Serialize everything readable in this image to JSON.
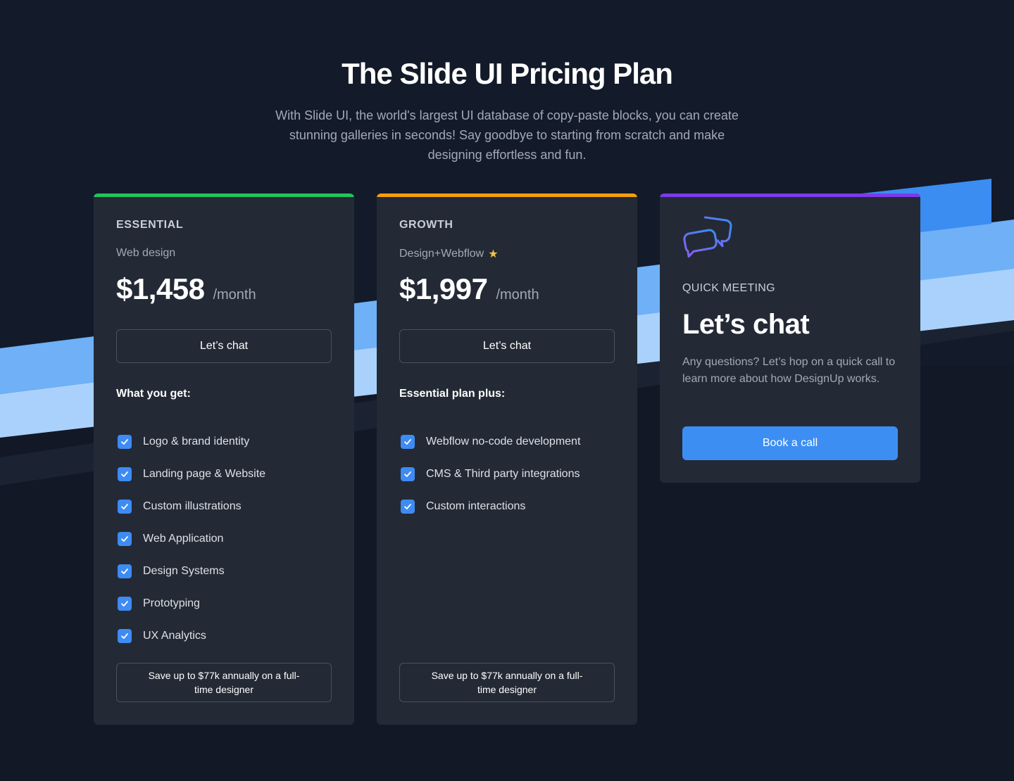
{
  "header": {
    "title": "The Slide UI Pricing Plan",
    "subtitle": "With Slide UI, the world's largest UI database of copy-paste blocks, you can create stunning galleries in seconds! Say goodbye to starting from scratch and make designing effortless and fun."
  },
  "colors": {
    "background": "#131a29",
    "card": "#232a35",
    "essential_accent": "#22c55e",
    "growth_accent": "#f59e0b",
    "meeting_accent": "#7c3aed",
    "primary_button": "#3d8ef2",
    "stripe_light": "#a9d1fb",
    "stripe_mid": "#6fb0f7",
    "stripe_dark": "#3b8df1"
  },
  "plans": [
    {
      "tier": "ESSENTIAL",
      "subtitle": "Web design",
      "price": "$1,458",
      "period": "/month",
      "cta": "Let’s chat",
      "list_heading": "What you get:",
      "features": [
        "Logo & brand identity",
        "Landing page & Website",
        "Custom illustrations",
        "Web Application",
        "Design Systems",
        "Prototyping",
        "UX Analytics"
      ],
      "savings": "Save up to $77k annually on a full-time designer"
    },
    {
      "tier": "GROWTH",
      "subtitle": "Design+Webflow",
      "subtitle_icon": "star-icon",
      "price": "$1,997",
      "period": "/month",
      "cta": "Let’s chat",
      "list_heading": "Essential plan plus:",
      "features": [
        "Webflow no-code development",
        "CMS & Third party integrations",
        "Custom interactions"
      ],
      "savings": "Save up to $77k annually on a full-time designer"
    }
  ],
  "meeting": {
    "icon": "chat-bubbles-icon",
    "label": "QUICK MEETING",
    "title": "Let’s chat",
    "text": "Any questions? Let’s hop on a quick call to learn more about how DesignUp works.",
    "cta": "Book a call"
  }
}
